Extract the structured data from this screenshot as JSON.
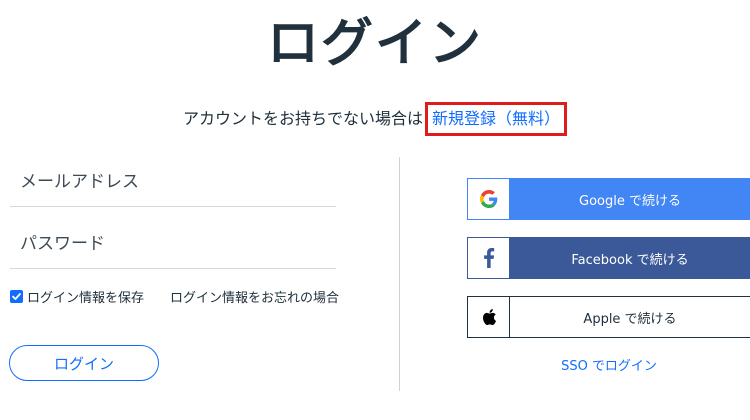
{
  "page": {
    "title": "ログイン",
    "signup_prompt": "アカウントをお持ちでない場合は",
    "signup_link": "新規登録（無料）"
  },
  "form": {
    "email_placeholder": "メールアドレス",
    "email_value": "",
    "password_placeholder": "パスワード",
    "password_value": "",
    "remember_label": "ログイン情報を保存",
    "remember_checked": true,
    "forgot_label": "ログイン情報をお忘れの場合",
    "login_button": "ログイン"
  },
  "social": {
    "google_label": "Google で続ける",
    "facebook_label": "Facebook で続ける",
    "apple_label": "Apple で続ける",
    "sso_label": "SSO でログイン"
  },
  "colors": {
    "link": "#116dff",
    "highlight_border": "#e01b1b",
    "google": "#4285f4",
    "facebook": "#3b5998",
    "text": "#20303c"
  },
  "icons": {
    "google": "google-icon",
    "facebook": "facebook-icon",
    "apple": "apple-icon",
    "checkbox": "checkmark-icon"
  }
}
